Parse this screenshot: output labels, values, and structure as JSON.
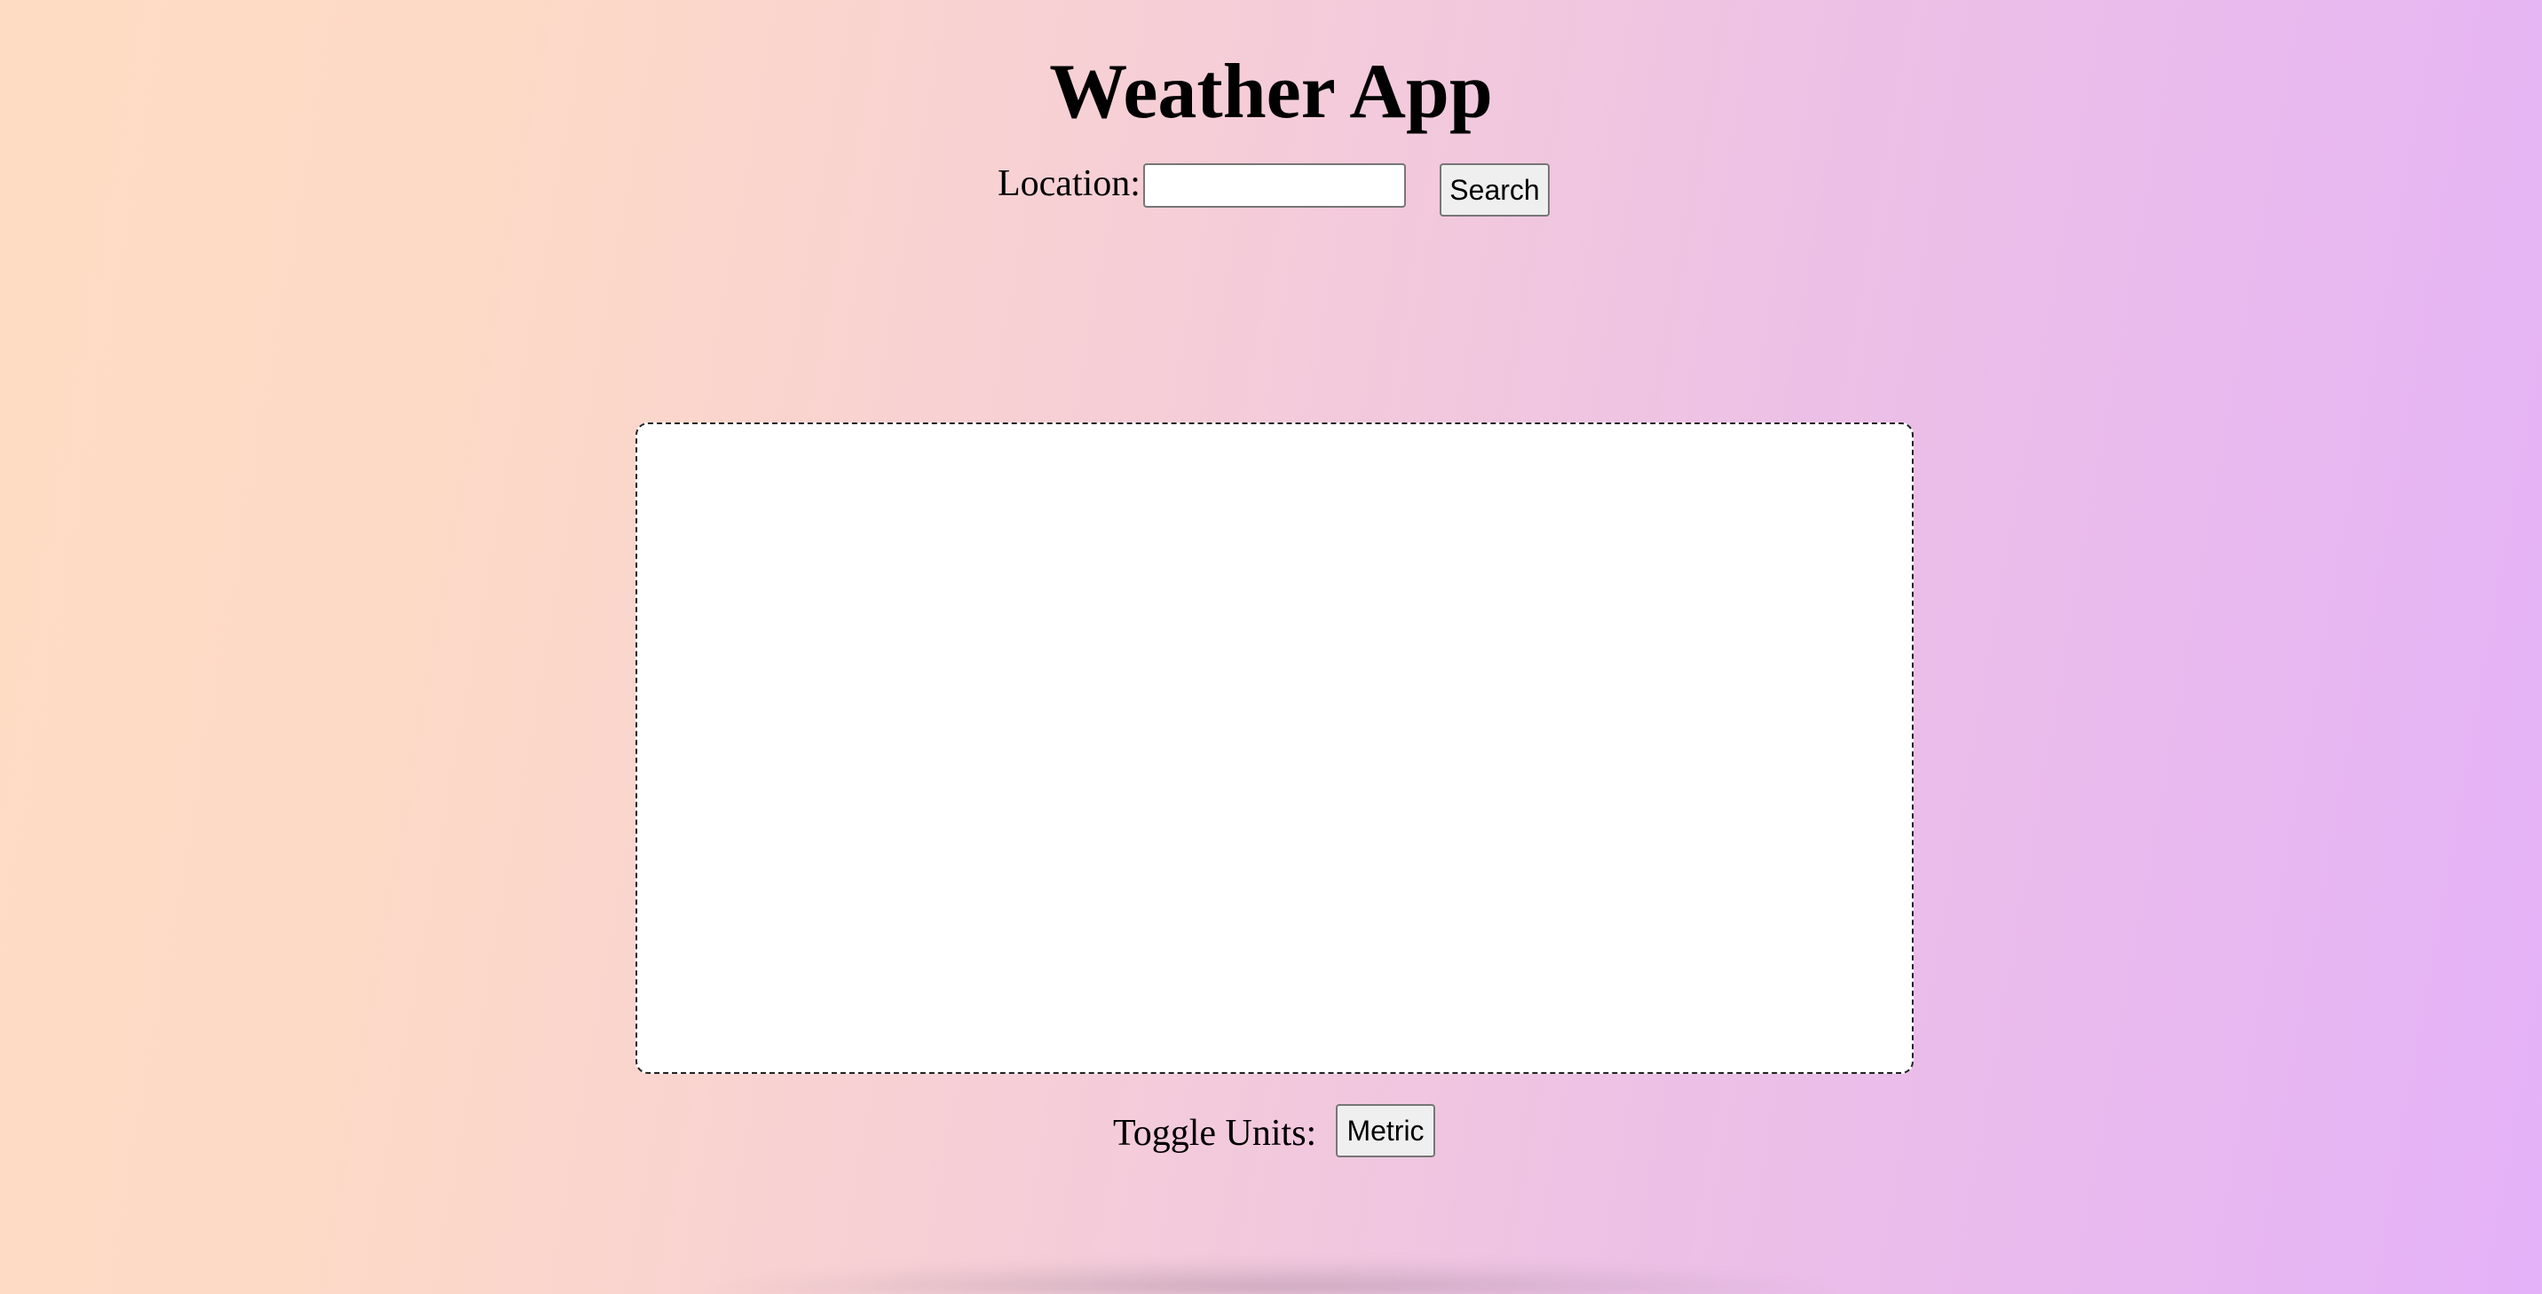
{
  "app": {
    "title": "Weather App"
  },
  "search": {
    "label": "Location:",
    "value": "",
    "placeholder": "",
    "button_label": "Search"
  },
  "weather_panel": {
    "content": ""
  },
  "units": {
    "label": "Toggle Units:",
    "button_label": "Metric"
  },
  "colors": {
    "background_left": "#fedcc4",
    "background_right": "#e4b2f8",
    "panel": "#ffffff",
    "button": "#efefef"
  }
}
